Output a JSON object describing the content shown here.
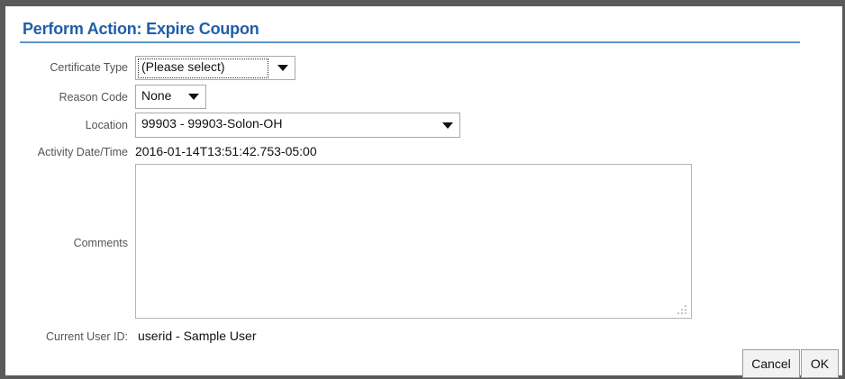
{
  "dialog": {
    "title": "Perform Action: Expire Coupon"
  },
  "form": {
    "certificate_type": {
      "label": "Certificate Type",
      "value": "(Please select)"
    },
    "reason_code": {
      "label": "Reason Code",
      "value": "None"
    },
    "location": {
      "label": "Location",
      "value": "99903 - 99903-Solon-OH"
    },
    "activity_datetime": {
      "label": "Activity Date/Time",
      "value": "2016-01-14T13:51:42.753-05:00"
    },
    "comments": {
      "label": "Comments",
      "value": ""
    },
    "current_user": {
      "label": "Current User ID:",
      "value": "userid - Sample User"
    }
  },
  "buttons": {
    "cancel": "Cancel",
    "ok": "OK"
  },
  "colors": {
    "title": "#1f5ea8",
    "title_rule": "#5b95cc",
    "frame": "#5a5a5a"
  }
}
